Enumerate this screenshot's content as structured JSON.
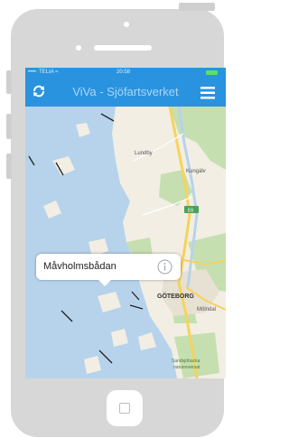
{
  "status_bar": {
    "carrier": "••••◦ TELIA ≈",
    "time": "20:58"
  },
  "nav": {
    "title": "ViVa - Sjöfartsverket"
  },
  "map": {
    "labels": {
      "lunden": "Lundby",
      "kungalv": "Kungälv",
      "goteborg": "GÖTEBORG",
      "molndal": "Mölndal",
      "reserve": "Sandsjöbacka",
      "reserve2": "naturreservat",
      "road_badge": "E6"
    }
  },
  "callout": {
    "station_name": "Måvholmsbådan"
  },
  "colors": {
    "nav_blue": "#2a93df",
    "sea": "#b7d3ec",
    "land": "#f2eee3",
    "forest": "#c5dfb0",
    "road": "#f5d35c"
  }
}
